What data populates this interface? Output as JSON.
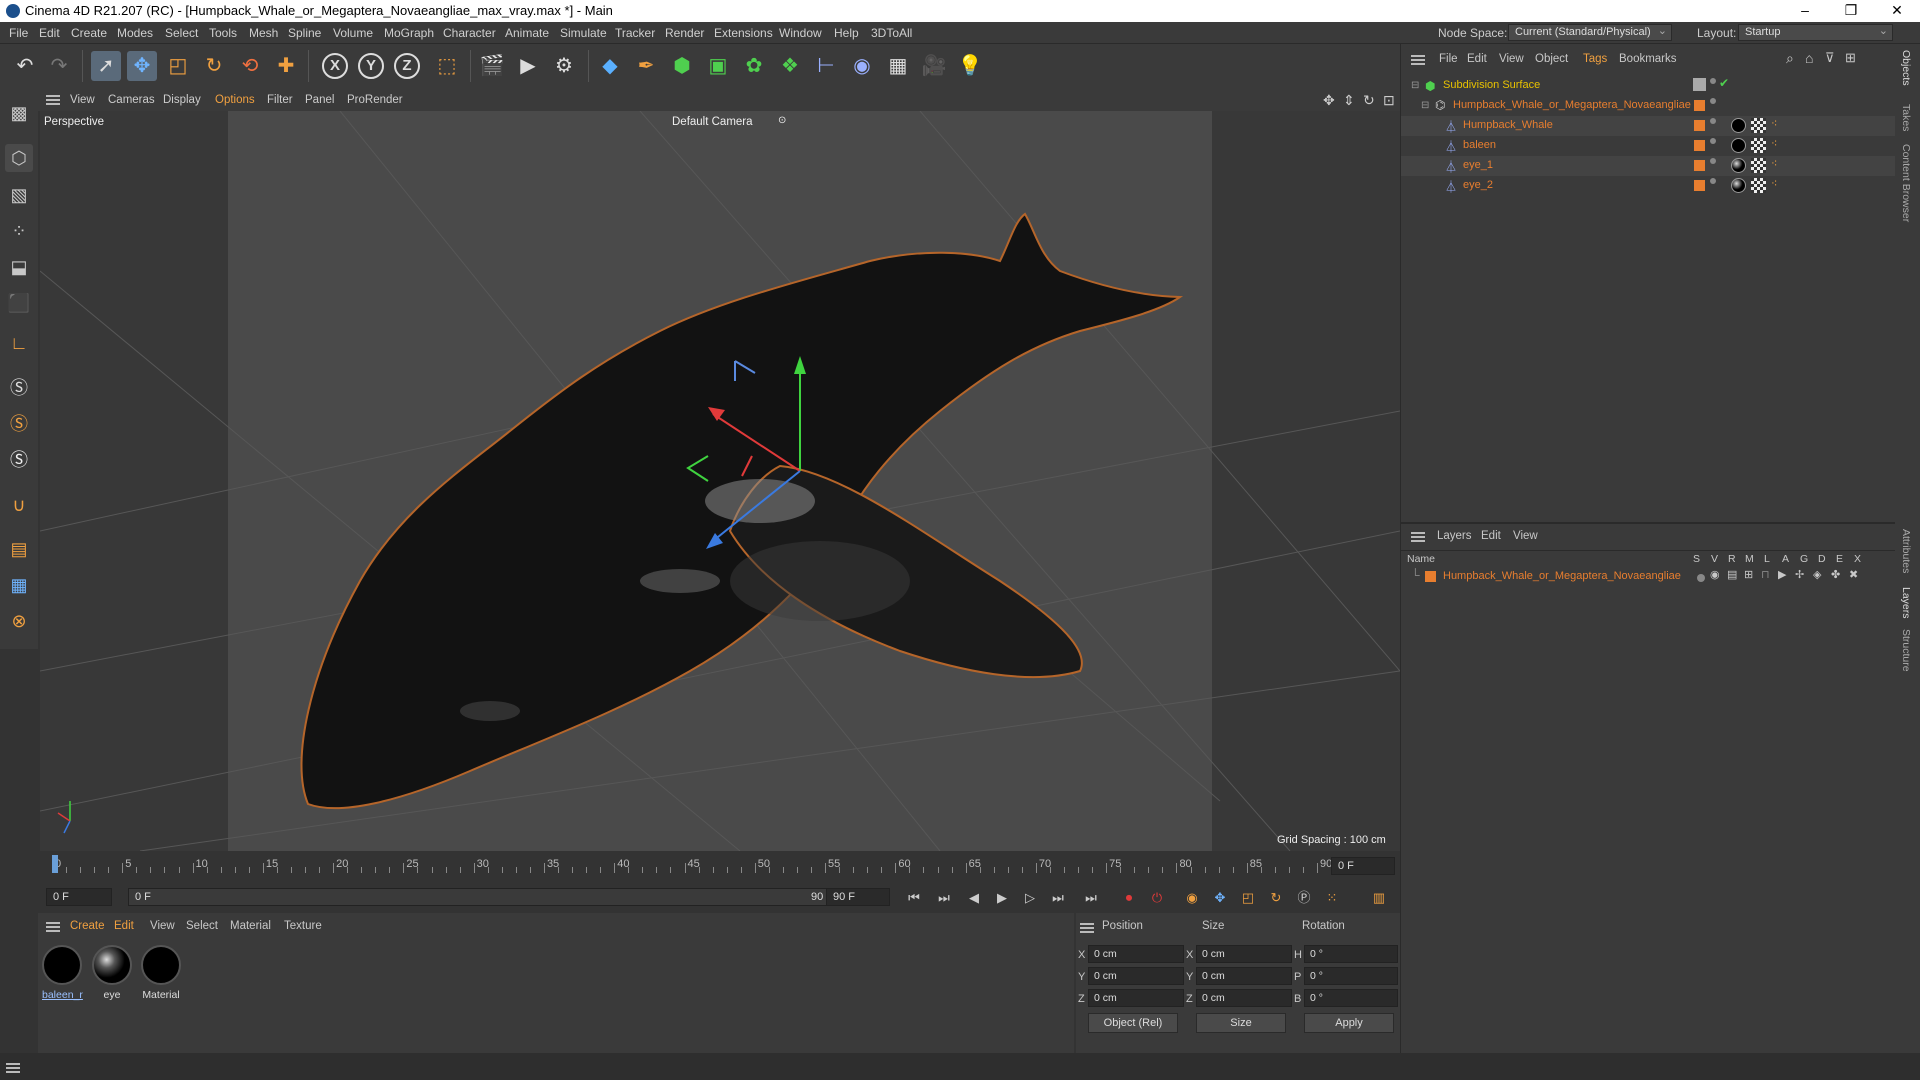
{
  "titlebar": {
    "title": "Cinema 4D R21.207 (RC) - [Humpback_Whale_or_Megaptera_Novaeangliae_max_vray.max *] - Main",
    "minimize": "–",
    "maximize": "❐",
    "close": "✕"
  },
  "menu": [
    "File",
    "Edit",
    "Create",
    "Modes",
    "Select",
    "Tools",
    "Mesh",
    "Spline",
    "Volume",
    "MoGraph",
    "Character",
    "Animate",
    "Simulate",
    "Tracker",
    "Render",
    "Extensions",
    "Window",
    "Help",
    "3DToAll"
  ],
  "node_space": {
    "label": "Node Space:",
    "value": "Current (Standard/Physical)"
  },
  "layout": {
    "label": "Layout:",
    "value": "Startup"
  },
  "viewport_menu": [
    "View",
    "Cameras",
    "Display",
    "Options",
    "Filter",
    "Panel",
    "ProRender"
  ],
  "viewport": {
    "name": "Perspective",
    "camera": "Default Camera",
    "grid_spacing": "Grid Spacing : 100 cm"
  },
  "timeline": {
    "ticks": [
      "0",
      "5",
      "10",
      "15",
      "20",
      "25",
      "30",
      "35",
      "40",
      "45",
      "50",
      "55",
      "60",
      "65",
      "70",
      "75",
      "80",
      "85",
      "90"
    ],
    "current_frame": "0 F"
  },
  "transport": {
    "start": "0 F",
    "range_start": "0 F",
    "range_end": "90 F",
    "end": "90 F"
  },
  "material_menu": [
    "Create",
    "Edit",
    "View",
    "Select",
    "Material",
    "Texture"
  ],
  "materials": [
    {
      "label": "baleen_r"
    },
    {
      "label": "eye"
    },
    {
      "label": "Material"
    }
  ],
  "attributes": {
    "headers": [
      "Position",
      "Size",
      "Rotation"
    ],
    "rows": [
      {
        "axis": "X",
        "pos": "0 cm",
        "saxis": "X",
        "size": "0 cm",
        "raxis": "H",
        "rot": "0 °"
      },
      {
        "axis": "Y",
        "pos": "0 cm",
        "saxis": "Y",
        "size": "0 cm",
        "raxis": "P",
        "rot": "0 °"
      },
      {
        "axis": "Z",
        "pos": "0 cm",
        "saxis": "Z",
        "size": "0 cm",
        "raxis": "B",
        "rot": "0 °"
      }
    ],
    "mode": "Object (Rel)",
    "size_mode": "Size",
    "apply": "Apply"
  },
  "object_menu": [
    "File",
    "Edit",
    "View",
    "Object",
    "Tags",
    "Bookmarks"
  ],
  "objects": [
    {
      "name": "Subdivision Surface",
      "color": "#e8c200"
    },
    {
      "name": "Humpback_Whale_or_Megaptera_Novaeangliae",
      "color": "#e87e2f"
    },
    {
      "name": "Humpback_Whale",
      "color": "#e87e2f"
    },
    {
      "name": "baleen",
      "color": "#e87e2f"
    },
    {
      "name": "eye_1",
      "color": "#e87e2f"
    },
    {
      "name": "eye_2",
      "color": "#e87e2f"
    }
  ],
  "layer_menu": [
    "Layers",
    "Edit",
    "View"
  ],
  "layer_columns": {
    "name": "Name",
    "flags": [
      "S",
      "V",
      "R",
      "M",
      "L",
      "A",
      "G",
      "D",
      "E",
      "X"
    ]
  },
  "layers": [
    {
      "name": "Humpback_Whale_or_Megaptera_Novaeangliae"
    }
  ],
  "side_tabs": [
    "Objects",
    "Takes",
    "Content Browser",
    "Attributes",
    "Layers",
    "Structure"
  ]
}
